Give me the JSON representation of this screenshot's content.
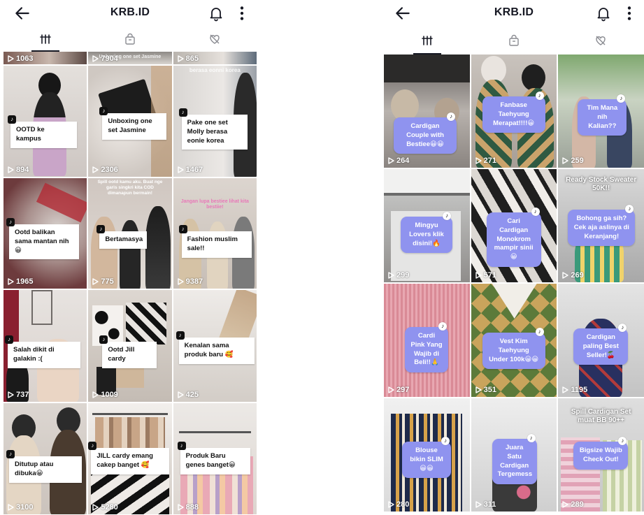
{
  "colors": {
    "text": "#161823",
    "sticker_purple": "#8f93ef",
    "white": "#ffffff"
  },
  "icons": {
    "back": "arrow-left-icon",
    "bell": "bell-icon",
    "more": "more-vertical-icon",
    "tab_grid": "grid-icon",
    "tab_shop": "shopping-bag-icon",
    "tab_liked": "heart-slash-icon",
    "play": "play-icon",
    "tiktok": "tiktok-icon"
  },
  "left": {
    "title": "KRB.ID",
    "partial_views": [
      "1063",
      "7904",
      "865"
    ],
    "partial_overlay": "Unboxing one set Jasmine",
    "videos": [
      {
        "views": "894",
        "caption": "OOTD ke kampus"
      },
      {
        "views": "2306",
        "caption": "Unboxing one set Jasmine"
      },
      {
        "views": "1467",
        "caption": "Pake one set Molly berasa eonie korea",
        "overlay": "berasa eonni korea"
      },
      {
        "views": "1965",
        "caption": "Ootd balikan sama mantan nih😀"
      },
      {
        "views": "775",
        "caption": "Bertamasya",
        "overlay": "Spill ootd kamu aku. Buat nge garis singkri kita COD dimanapun bermain!"
      },
      {
        "views": "9387",
        "caption": "Fashion muslim sale!!",
        "overlay": "Jangan lupa bestiee lihat kita bestiie!"
      },
      {
        "views": "737",
        "caption": "Salah dikit di galakin :("
      },
      {
        "views": "1009",
        "caption": "Ootd Jill cardy"
      },
      {
        "views": "425",
        "caption": "Kenalan sama produk baru 🥰"
      },
      {
        "views": "3100",
        "caption": "Ditutup atau dibuka😀"
      },
      {
        "views": "5280",
        "caption": "JILL cardy emang cakep banget 🥰"
      },
      {
        "views": "888",
        "caption": "Produk Baru genes banget😀"
      }
    ]
  },
  "right": {
    "title": "KRB.ID",
    "videos": [
      {
        "views": "264",
        "caption": "Cardigan Couple with Bestiee😀😀"
      },
      {
        "views": "271",
        "caption": "Fanbase Taehyung Merapat!!!!😀"
      },
      {
        "views": "259",
        "caption": "Tim Mana nih Kalian??"
      },
      {
        "views": "299",
        "caption": "Mingyu Lovers klik disini!🔥"
      },
      {
        "views": "571",
        "caption": "Cari Cardigan Monokrom mampir sinii😀"
      },
      {
        "views": "269",
        "caption": "Bohong ga sih? Cek aja aslinya di Keranjang!",
        "overlay": "Ready Stock Sweater 50K!!"
      },
      {
        "views": "297",
        "caption": "Cardi Pink Yang Wajib di Beli!!🙏"
      },
      {
        "views": "351",
        "caption": "Vest Kim Taehyung Under 100k😀😀"
      },
      {
        "views": "1195",
        "caption": "Cardigan paling Best Seller!🍒"
      },
      {
        "views": "280",
        "caption": "Blouse bikin SLIM😀😀"
      },
      {
        "views": "311",
        "caption": "Juara Satu Cardigan Tergemess"
      },
      {
        "views": "289",
        "caption": "Bigsize Wajib Check Out!",
        "overlay": "Spill Cardigan Set muat BB 90++"
      }
    ]
  }
}
